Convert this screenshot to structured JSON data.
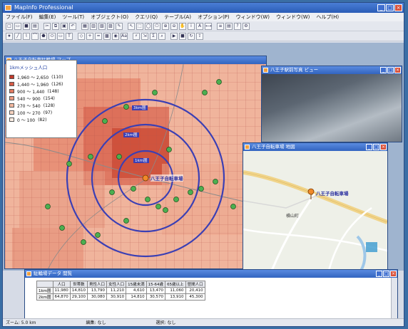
{
  "app": {
    "title": "MapInfo Professional"
  },
  "menu": [
    "ファイル(F)",
    "編集(E)",
    "ツール(T)",
    "オブジェクト(O)",
    "クエリ(Q)",
    "テーブル(A)",
    "オプション(P)",
    "ウィンドウ(W)",
    "ウィンドウ(W)",
    "ヘルプ(H)"
  ],
  "map_window": {
    "title": "八王子自転車駐輪場 マップ",
    "legend_title": "1kmメッシュ人口",
    "legend_rows": [
      {
        "range": "1,960 ～ 2,650",
        "count": "(110)",
        "color": "#c0392b"
      },
      {
        "range": "1,440 ～ 1,960",
        "count": "(126)",
        "color": "#d65a45"
      },
      {
        "range": "900 ～ 1,440",
        "count": "(148)",
        "color": "#e07a60"
      },
      {
        "range": "540 ～ 900",
        "count": "(154)",
        "color": "#eb9a80"
      },
      {
        "range": "270 ～ 540",
        "count": "(128)",
        "color": "#f2b8a0"
      },
      {
        "range": "100 ～ 270",
        "count": "(97)",
        "color": "#f8d4c0"
      },
      {
        "range": "0 ～ 100",
        "count": "(82)",
        "color": "#fdeee4"
      }
    ],
    "ring_labels": [
      "3km圏",
      "2km圏",
      "1km圏"
    ],
    "center_label": "八王子自転車場"
  },
  "photo_window": {
    "title": "八王子駅前写真 ビュー"
  },
  "road_window": {
    "title": "八王子自転車場 地図",
    "label": "八王子自転車場",
    "area": "横山町"
  },
  "table_window": {
    "title": "駐輪場データ 閲覧",
    "headers": [
      "",
      "人口",
      "世帯数",
      "男性人口",
      "女性人口",
      "15歳未満",
      "15-64歳",
      "65歳以上",
      "昼間人口"
    ],
    "rows": [
      [
        "1km圏",
        "11,980",
        "14,810",
        "13,790",
        "11,210",
        "4,610",
        "13,470",
        "11,060",
        "20,410"
      ],
      [
        "2km圏",
        "64,870",
        "29,100",
        "30,080",
        "30,910",
        "14,810",
        "30,570",
        "13,910",
        "45,300"
      ]
    ]
  },
  "status": [
    "ズーム: 5.0 km",
    "編集: なし",
    "選択: なし"
  ]
}
